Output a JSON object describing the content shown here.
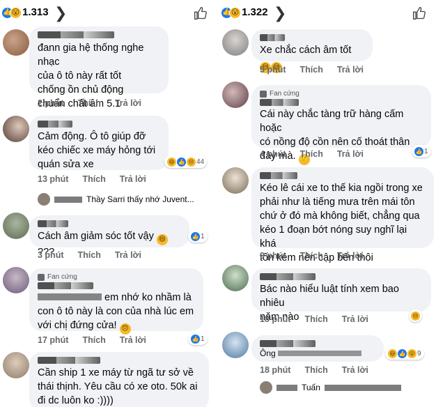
{
  "left": {
    "reaction_count": "1.313",
    "chevron": "❯",
    "comments": [
      {
        "text": "đann gia hệ thống nghe nhạc\ncủa ô tô này rất tốt\nchống ồn chủ động\nchuẩn chất âm 5.1",
        "time": "2 phút",
        "like": "Thích",
        "reply": "Trả lời"
      },
      {
        "text": "Cảm động. Ô tô giúp đỡ\nkéo chiếc xe máy hỏng tới\nquán sửa xe",
        "time": "13 phút",
        "like": "Thích",
        "reply": "Trả lời",
        "reactions": "44"
      },
      {
        "text": "Cách âm giảm sóc tốt vậy",
        "emoji_suffix": "???",
        "time": "3 phút",
        "like": "Thích",
        "reply": "Trả lời",
        "reactions": "1"
      },
      {
        "badge": "Fan cứng",
        "text": "em nhớ ko nhầm là\ncon ô tô này là con của nhà lúc em\nvới chị đứng cửa!",
        "time": "17 phút",
        "like": "Thích",
        "reply": "Trả lời",
        "reactions": "1"
      },
      {
        "text": "Cần ship 1 xe máy từ ngã tư sở về\nthái thịnh. Yêu cầu có xe oto. 50k ai\nđi dc luôn ko :))))"
      }
    ],
    "reply_preview": "Thầy Sarri thấy nhớ Juvent..."
  },
  "right": {
    "reaction_count": "1.322",
    "chevron": "❯",
    "comments": [
      {
        "text": "Xe chắc cách âm tốt",
        "time": "5 phút",
        "like": "Thích",
        "reply": "Trả lời"
      },
      {
        "badge": "Fan cứng",
        "text": "Cái này chắc tàng trữ hàng cấm hoặc\ncó nồng độ cồn nên cố thoát thân\nđây mà.",
        "time": "4 phút",
        "like": "Thích",
        "reply": "Trả lời",
        "reactions": "1"
      },
      {
        "text": "Kéo lê cái xe to thế kia ngồi trong xe\nphải như là tiếng mưa trên mái tôn\nchứ ở đó mà không biết, chẳng qua\nkéo 1 đoạn bớt nóng suy nghĩ lại khá\ntốn kém nên cập bến thôi",
        "time": "9 phút",
        "like": "Thích",
        "reply": "Trả lời"
      },
      {
        "text": "Bác nào hiểu luật tính xem bao nhiêu\nnăm nào",
        "time": "18 phút",
        "like": "Thích",
        "reply": "Trả lời"
      },
      {
        "text": "Ông",
        "time": "18 phút",
        "like": "Thích",
        "reply": "Trả lời",
        "reactions": "9"
      }
    ],
    "reply_preview": "Tuấn"
  },
  "colors": {
    "like": "#1877f2",
    "bubble": "#f0f2f5",
    "meta": "#65676b"
  }
}
